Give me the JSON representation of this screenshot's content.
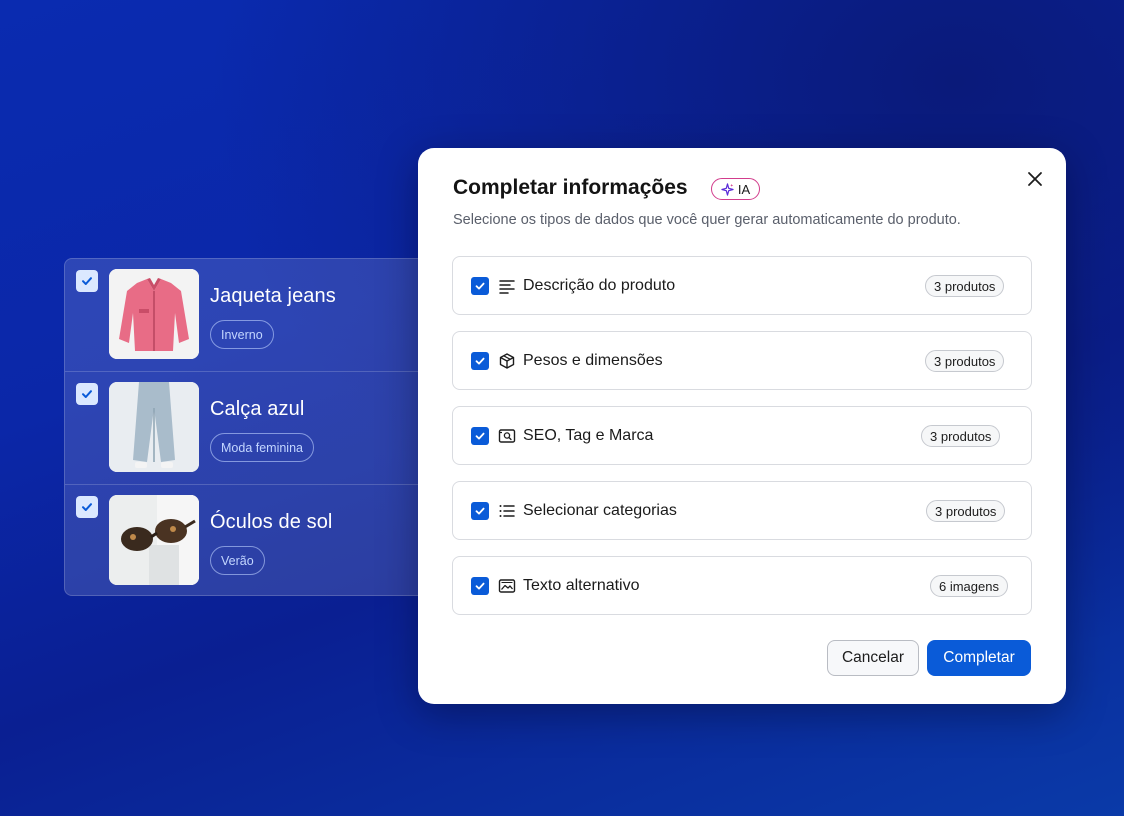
{
  "products": [
    {
      "name": "Jaqueta jeans",
      "tag": "Inverno",
      "image": "pink-jacket-image",
      "checked": true
    },
    {
      "name": "Calça azul",
      "tag": "Moda feminina",
      "image": "blue-pants-image",
      "checked": true
    },
    {
      "name": "Óculos de sol",
      "tag": "Verão",
      "image": "sunglasses-image",
      "checked": true
    }
  ],
  "modal": {
    "title": "Completar informações",
    "ai_badge": "IA",
    "subtitle": "Selecione os tipos de dados que você quer gerar automaticamente do produto.",
    "options": [
      {
        "label": "Descrição do produto",
        "count": "3 produtos",
        "icon": "text-align-icon",
        "checked": true
      },
      {
        "label": "Pesos e dimensões",
        "count": "3 produtos",
        "icon": "box-icon",
        "checked": true
      },
      {
        "label": "SEO, Tag e Marca",
        "count": "3 produtos",
        "icon": "seo-search-icon",
        "checked": true
      },
      {
        "label": "Selecionar categorias",
        "count": "3 produtos",
        "icon": "list-icon",
        "checked": true
      },
      {
        "label": "Texto alternativo",
        "count": "6 imagens",
        "icon": "image-icon",
        "checked": true
      }
    ],
    "cancel_label": "Cancelar",
    "confirm_label": "Completar"
  },
  "colors": {
    "primary": "#0a5bd8",
    "ai_badge_border": "#d23c8c",
    "background_top": "#0a1a7a",
    "background_bottom": "#0a3aa8"
  }
}
